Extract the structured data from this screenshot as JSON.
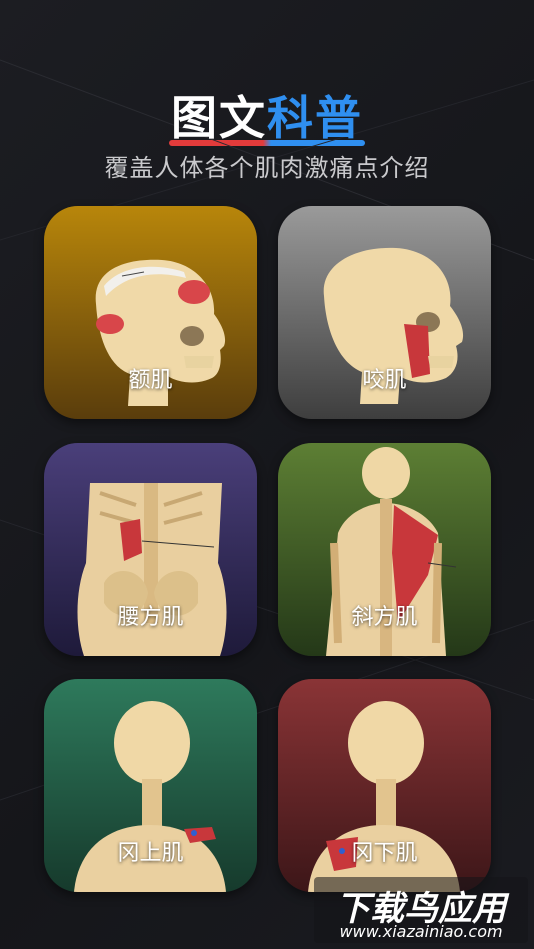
{
  "header": {
    "title_part1": "图文",
    "title_part2": "科普",
    "subtitle": "覆盖人体各个肌肉激痛点介绍"
  },
  "colors": {
    "accent_red": "#e23b3b",
    "accent_blue": "#2f8ff0"
  },
  "cards": [
    {
      "label": "额肌",
      "icon": "skull-side-icon",
      "color": "#b8860b"
    },
    {
      "label": "咬肌",
      "icon": "skull-side-icon",
      "color": "#8a8a8a"
    },
    {
      "label": "腰方肌",
      "icon": "lower-back-icon",
      "color": "#3d3566"
    },
    {
      "label": "斜方肌",
      "icon": "upper-back-icon",
      "color": "#4f6b2c"
    },
    {
      "label": "冈上肌",
      "icon": "skull-back-icon",
      "color": "#2c6a52"
    },
    {
      "label": "冈下肌",
      "icon": "skull-back-icon",
      "color": "#7a2e30"
    }
  ],
  "watermark": {
    "main": "下载鸟应用",
    "sub": "www.xiazainiao.com"
  }
}
